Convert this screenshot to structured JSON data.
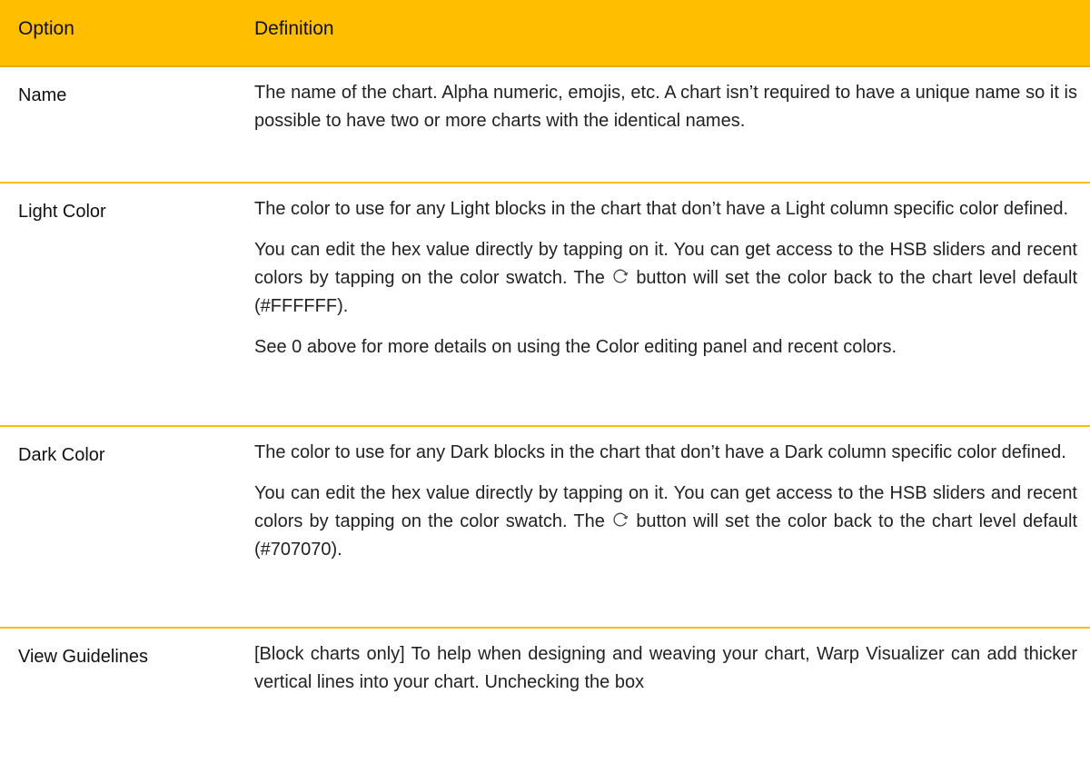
{
  "header": {
    "option": "Option",
    "definition": "Definition"
  },
  "rows": [
    {
      "option": "Name",
      "paragraphs": [
        "The name of the chart. Alpha numeric, emojis, etc. A chart isn’t required to have a unique name so it is possible to have two or more charts with the identical names."
      ]
    },
    {
      "option": "Light Color",
      "paragraphs": [
        "The color to use for any Light blocks in the chart that don’t have a Light column specific color defined.",
        {
          "before_icon": "You can edit the hex value directly by tapping on it. You can get access to the HSB sliders and recent colors by tapping on the color swatch. The",
          "icon": "refresh-icon",
          "after_icon": "button will set the color back to the chart level default (#FFFFFF)."
        },
        "See 0 above for more details on using the Color editing panel and recent colors."
      ]
    },
    {
      "option": "Dark Color",
      "paragraphs": [
        "The color to use for any Dark blocks in the chart that don’t have a Dark column specific color defined.",
        {
          "before_icon": "You can edit the hex value directly by tapping on it. You can get access to the HSB sliders and recent colors by tapping on the color swatch. The",
          "icon": "refresh-icon",
          "after_icon": "button will set the color back to the chart level default (#707070)."
        }
      ]
    },
    {
      "option": "View Guidelines",
      "paragraphs": [
        "[Block charts only] To help when designing and weaving your chart, Warp Visualizer can add thicker vertical lines into your chart. Unchecking the box"
      ]
    }
  ],
  "colors": {
    "header_bg": "#FFBF00",
    "row_border": "#FFBF00",
    "text": "#222222"
  }
}
